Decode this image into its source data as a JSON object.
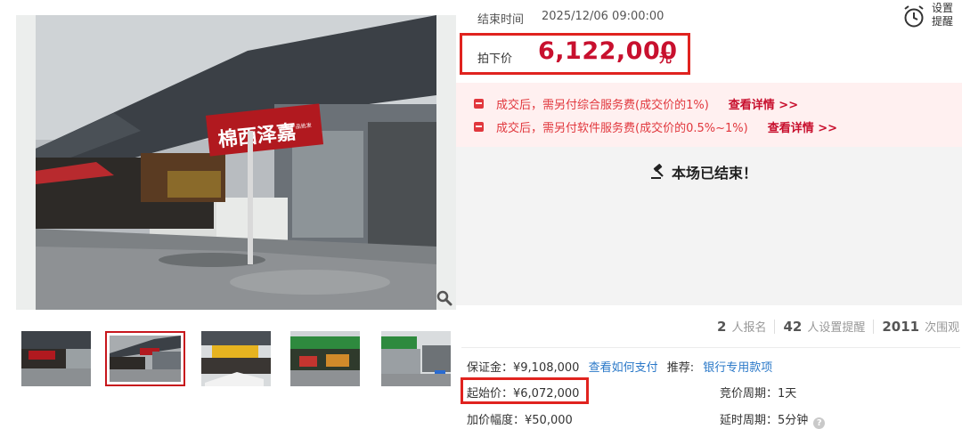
{
  "auction": {
    "end_time_label": "结束时间",
    "end_time_value": "2025/12/06 09:00:00",
    "reminder_label_1": "设置",
    "reminder_label_2": "提醒",
    "sold_label": "拍下价",
    "sold_price": "6,122,000",
    "sold_unit": "元"
  },
  "notices": [
    {
      "text": "成交后，需另付综合服务费(成交价的1%)",
      "link": "查看详情 >>"
    },
    {
      "text": "成交后，需另付软件服务费(成交价的0.5%~1%)",
      "link": "查看详情 >>"
    }
  ],
  "status": {
    "ended_text": "本场已结束！"
  },
  "stats": {
    "signups_count": "2",
    "signups_label": "人报名",
    "reminders_count": "42",
    "reminders_label": "人设置提醒",
    "views_count": "2011",
    "views_label": "次围观"
  },
  "details": {
    "deposit": "保证金：¥9,108,000",
    "deposit_link": "查看如何支付",
    "recommend_label": "推荐:",
    "recommend_link": "银行专用款项",
    "start_price": "起始价：¥6,072,000",
    "bid_cycle": "竞价周期：1天",
    "increment": "加价幅度：¥50,000",
    "delay_cycle": "延时周期：5分钟"
  },
  "photo": {
    "sign_text": "棉西泽嘉",
    "sign_subtext": "五金产品批发"
  },
  "colors": {
    "accent_red": "#c8102e",
    "highlight_box": "#e0231f",
    "notice_bg": "#fff0f0",
    "link_blue": "#2a78c8"
  },
  "icons": {
    "reminder": "alarm-clock-icon",
    "zoom": "magnifier-icon",
    "gavel": "gavel-icon",
    "notice": "gift-icon",
    "help": "question-icon"
  }
}
